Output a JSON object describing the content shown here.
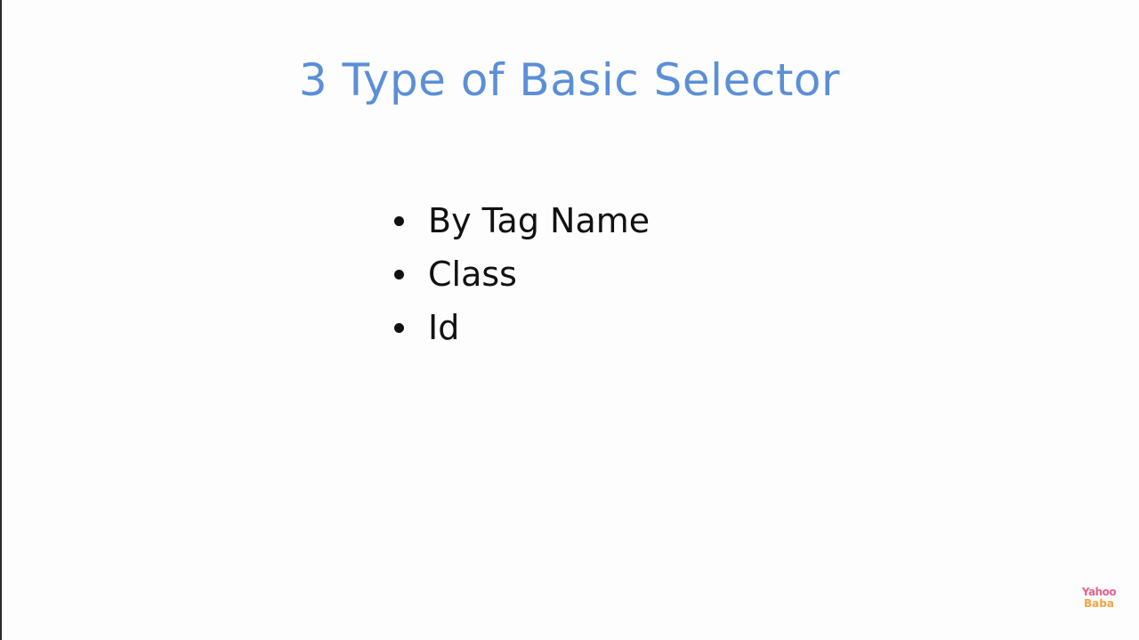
{
  "slide": {
    "title": "3 Type of Basic Selector",
    "bullets": [
      {
        "text": "By Tag Name"
      },
      {
        "text": "Class"
      },
      {
        "text": "Id"
      }
    ]
  },
  "watermark": {
    "line1": "Yahoo",
    "line2": "Baba",
    "line1_color": "#e8608f",
    "line2_color": "#f2a440"
  },
  "colors": {
    "title": "#5b8fd6",
    "text": "#111111",
    "background": "#fdfdfd"
  }
}
